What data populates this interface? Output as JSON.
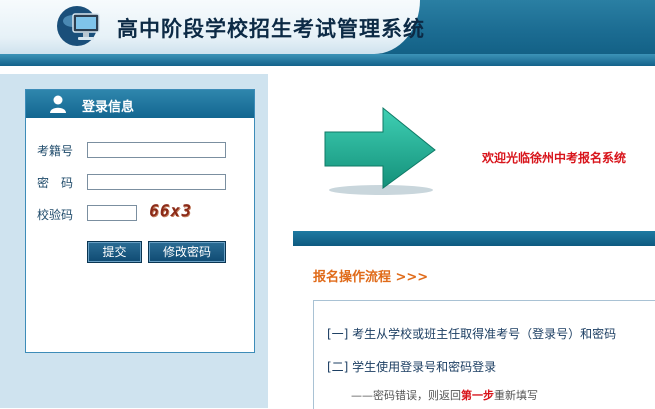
{
  "header": {
    "title": "高中阶段学校招生考试管理系统",
    "logo_icon": "monitor-globe-icon"
  },
  "login": {
    "heading": "登录信息",
    "heading_icon": "user-icon",
    "exam_id_label": "考籍号",
    "exam_id_value": "",
    "password_label": "密　码",
    "password_value": "",
    "captcha_label": "校验码",
    "captcha_value": "",
    "captcha_text": "66x3",
    "submit_label": "提交",
    "change_password_label": "修改密码"
  },
  "content": {
    "arrow_icon": "right-arrow-icon",
    "welcome": "欢迎光临徐州中考报名系统",
    "flow_title": "报名操作流程 >>>",
    "steps": [
      "[一] 考生从学校或班主任取得准考号（登录号）和密码",
      "[二] 学生使用登录号和密码登录"
    ],
    "error_prefix": "——密码错误，则返回",
    "error_highlight": "第一步",
    "error_suffix": "重新填写"
  },
  "colors": {
    "header_blue": "#1c6d93",
    "welcome_red": "#d8141b",
    "flow_orange": "#e06b1a",
    "button_blue": "#1d5d85"
  }
}
